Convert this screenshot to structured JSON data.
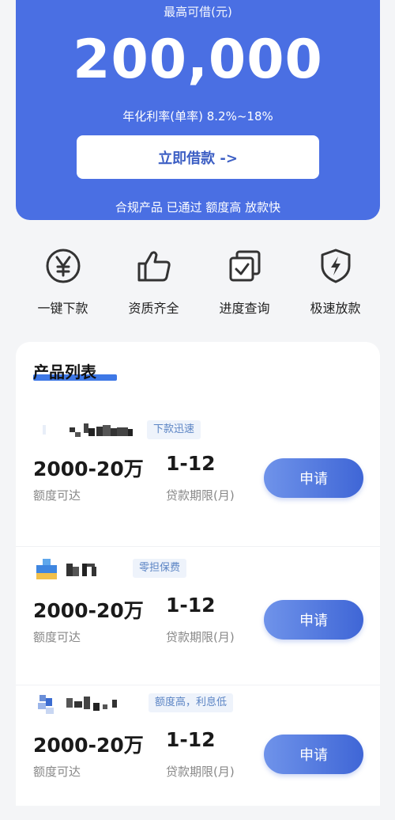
{
  "hero": {
    "caption": "最高可借(元)",
    "amount": "200,000",
    "rate": "年化利率(单率) 8.2%~18%",
    "cta_label": "立即借款 ->",
    "slogan": "合规产品 已通过 额度高 放款快"
  },
  "features": [
    {
      "icon": "yen-icon",
      "label": "一键下款"
    },
    {
      "icon": "thumbs-up-icon",
      "label": "资质齐全"
    },
    {
      "icon": "progress-check-icon",
      "label": "进度查询"
    },
    {
      "icon": "shield-lightning-icon",
      "label": "极速放款"
    }
  ],
  "products_section": {
    "title": "产品列表"
  },
  "products": [
    {
      "tag": "下款迅速",
      "amount_range": "2000-20万",
      "amount_label": "额度可达",
      "term": "1-12",
      "term_label": "贷款期限(月)",
      "apply_label": "申请"
    },
    {
      "tag": "零担保费",
      "amount_range": "2000-20万",
      "amount_label": "额度可达",
      "term": "1-12",
      "term_label": "贷款期限(月)",
      "apply_label": "申请"
    },
    {
      "tag": "额度高，利息低",
      "amount_range": "2000-20万",
      "amount_label": "额度可达",
      "term": "1-12",
      "term_label": "贷款期限(月)",
      "apply_label": "申请"
    }
  ],
  "colors": {
    "primary": "#4a6fe3",
    "button_gradient_start": "#6f93ea",
    "button_gradient_end": "#3f66d6",
    "tag_text": "#5b84c4",
    "tag_bg": "#eef3fb"
  }
}
